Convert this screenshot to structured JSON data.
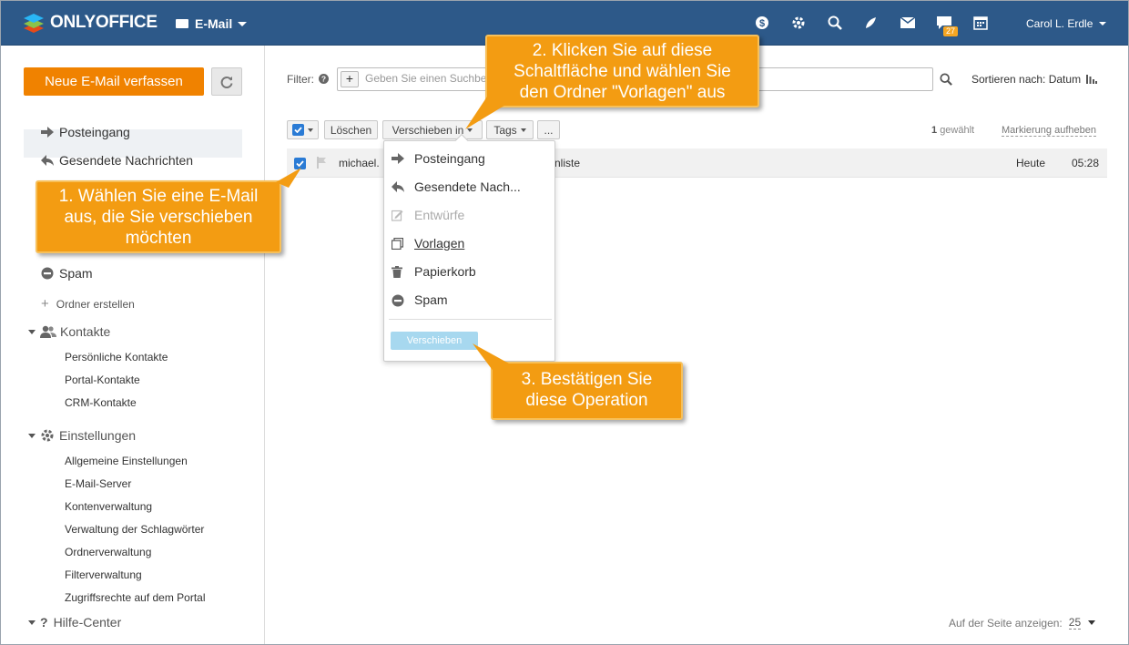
{
  "topbar": {
    "logo": "ONLYOFFICE",
    "module": "E-Mail",
    "user": "Carol L. Erdle",
    "chat_badge": "27",
    "icons": [
      "dollar-icon",
      "gear-icon",
      "search-icon",
      "feed-icon",
      "mail-icon",
      "chat-icon",
      "calendar-icon"
    ]
  },
  "sidebar": {
    "compose": "Neue E-Mail verfassen",
    "folders": {
      "inbox": "Posteingang",
      "sent": "Gesendete Nachrichten",
      "spam": "Spam"
    },
    "create_folder": "Ordner erstellen",
    "contacts": {
      "title": "Kontakte",
      "items": [
        "Persönliche Kontakte",
        "Portal-Kontakte",
        "CRM-Kontakte"
      ]
    },
    "settings": {
      "title": "Einstellungen",
      "items": [
        "Allgemeine Einstellungen",
        "E-Mail-Server",
        "Kontenverwaltung",
        "Verwaltung der Schlagwörter",
        "Ordnerverwaltung",
        "Filterverwaltung",
        "Zugriffsrechte auf dem Portal"
      ]
    },
    "help": "Hilfe-Center"
  },
  "filter": {
    "label": "Filter:",
    "placeholder": "Geben Sie einen Suchbegriff ein",
    "sort": "Sortieren nach: Datum"
  },
  "toolbar": {
    "delete": "Löschen",
    "move": "Verschieben in",
    "tags": "Tags",
    "more": "...",
    "selected_count": "1",
    "selected_label": "gewählt",
    "unmark": "Markierung aufheben"
  },
  "mail": {
    "from": "michael.",
    "subject": "nliste",
    "date": "Heute",
    "time": "05:28"
  },
  "move_menu": {
    "items": [
      "Posteingang",
      "Gesendete Nach...",
      "Entwürfe",
      "Vorlagen",
      "Papierkorb",
      "Spam"
    ],
    "confirm": "Verschieben"
  },
  "callouts": {
    "step1": [
      "1. Wählen Sie eine E-Mail",
      "aus, die Sie verschieben",
      "möchten"
    ],
    "step2": [
      "2. Klicken Sie auf diese",
      "Schaltfläche und wählen Sie",
      "den Ordner \"Vorlagen\" aus"
    ],
    "step3": [
      "3. Bestätigen Sie",
      "diese Operation"
    ]
  },
  "pager": {
    "label": "Auf der Seite anzeigen:",
    "value": "25"
  },
  "colors": {
    "topbar": "#2d5989",
    "accent": "#f08200",
    "callout": "#f39c12",
    "checkbox": "#2a7bd5"
  }
}
